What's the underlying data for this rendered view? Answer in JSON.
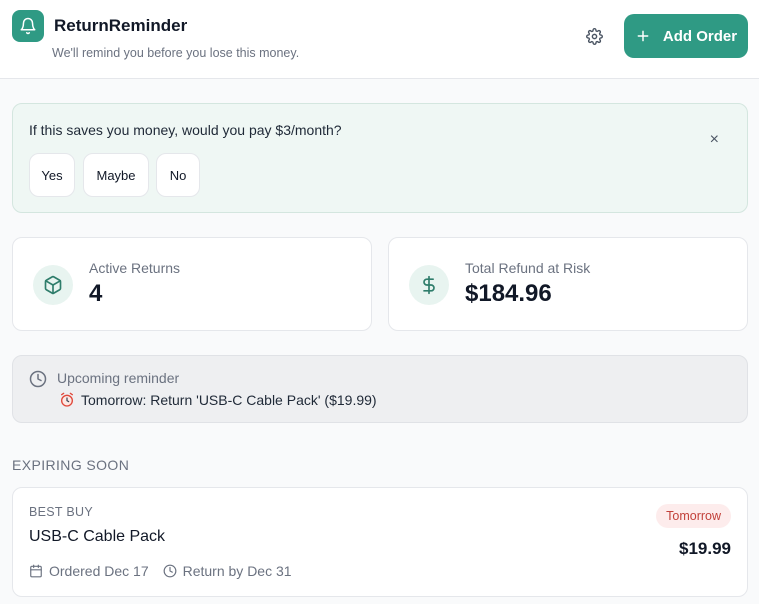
{
  "header": {
    "title": "ReturnReminder",
    "subtitle": "We'll remind you before you lose this money.",
    "logo_icon": "bell-icon",
    "settings_icon": "gear-icon",
    "add_button_label": "Add Order",
    "add_button_icon": "plus-icon"
  },
  "survey": {
    "question": "If this saves you money, would you pay $3/month?",
    "options": [
      "Yes",
      "Maybe",
      "No"
    ],
    "close_label": "×"
  },
  "stats": [
    {
      "label": "Active Returns",
      "value": "4",
      "icon": "box-icon"
    },
    {
      "label": "Total Refund at Risk",
      "value": "$184.96",
      "icon": "dollar-icon"
    }
  ],
  "reminder": {
    "title": "Upcoming reminder",
    "text": "Tomorrow: Return 'USB-C Cable Pack' ($19.99)",
    "icon": "clock-icon",
    "alarm_icon": "alarm-clock-icon"
  },
  "section": {
    "title": "EXPIRING SOON"
  },
  "orders": [
    {
      "store": "BEST BUY",
      "name": "USB-C Cable Pack",
      "ordered": "Ordered Dec 17",
      "return_by": "Return by Dec 31",
      "badge": "Tomorrow",
      "price": "$19.99"
    }
  ],
  "colors": {
    "accent": "#2f9a84",
    "survey_bg": "#eff7f4",
    "badge_bg": "#fdecec",
    "badge_text": "#c2413a"
  }
}
